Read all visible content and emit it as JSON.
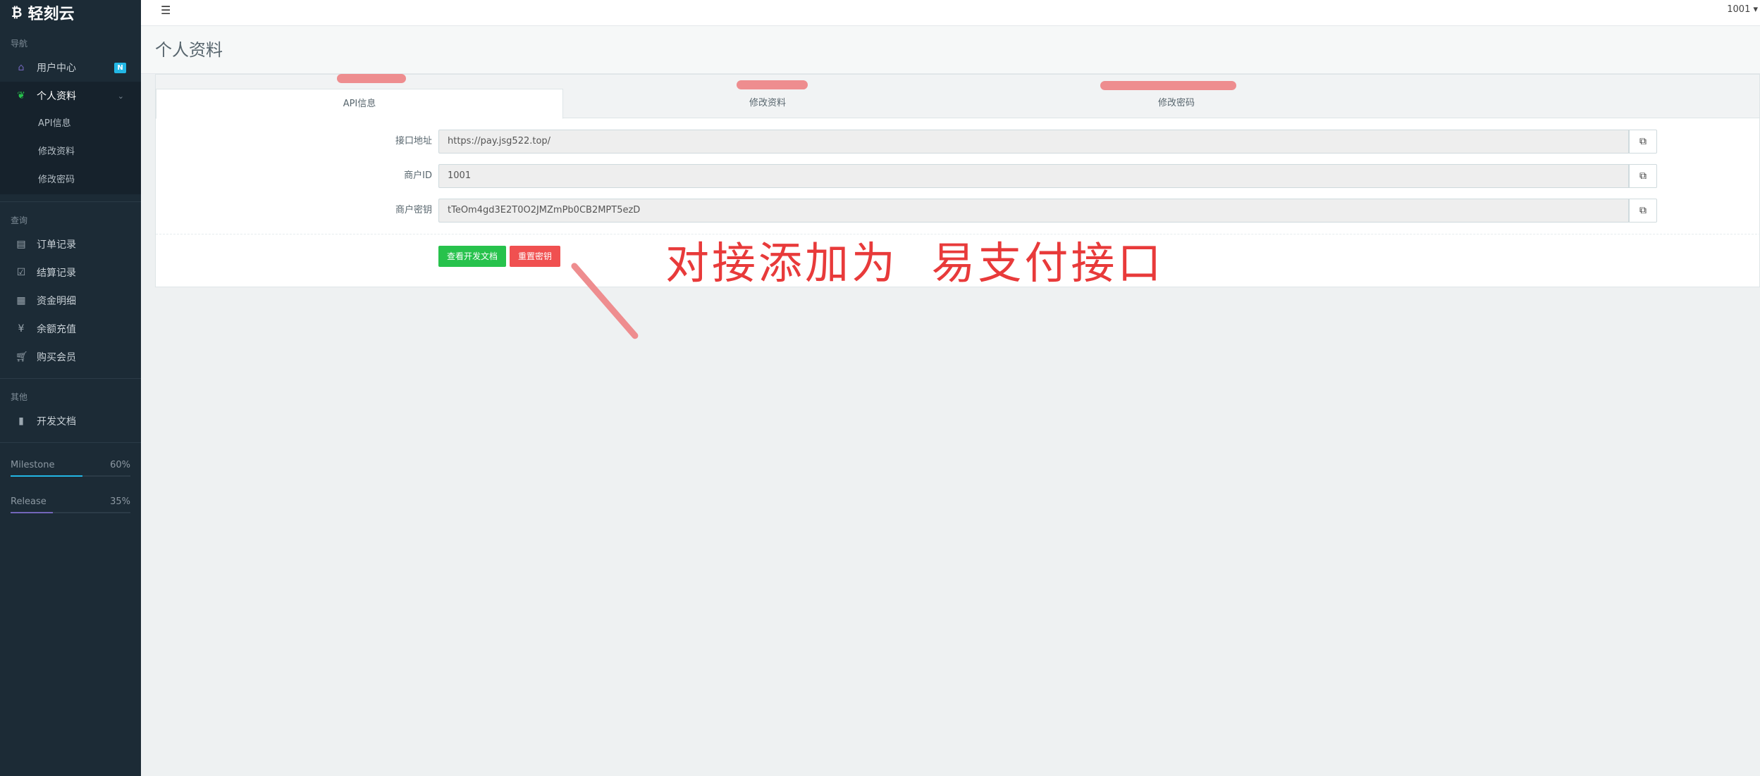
{
  "sidebar": {
    "brand": "轻刻云",
    "sections": {
      "nav": "导航",
      "query": "查询",
      "other": "其他"
    },
    "items": {
      "user_center": "用户中心",
      "user_center_badge": "N",
      "profile": "个人资料",
      "profile_sub": [
        "API信息",
        "修改资料",
        "修改密码"
      ],
      "orders": "订单记录",
      "settlements": "结算记录",
      "funds": "资金明细",
      "recharge": "余额充值",
      "membership": "购买会员",
      "docs": "开发文档"
    },
    "progress": [
      {
        "label": "Milestone",
        "value_text": "60%",
        "value": 60,
        "color": "#23b7e5"
      },
      {
        "label": "Release",
        "value_text": "35%",
        "value": 35,
        "color": "#7266ba"
      }
    ]
  },
  "header": {
    "user": "1001 ▾"
  },
  "page": {
    "title": "个人资料"
  },
  "tabs": [
    "API信息",
    "修改资料",
    "修改密码"
  ],
  "form": {
    "fields": [
      {
        "label": "接口地址",
        "value": "https://pay.jsg522.top/"
      },
      {
        "label": "商户ID",
        "value": "1001"
      },
      {
        "label": "商户密钥",
        "value": "tTeOm4gd3E2T0O2JMZmPb0CB2MPT5ezD"
      }
    ],
    "buttons": {
      "docs": "查看开发文档",
      "reset": "重置密钥"
    }
  },
  "annotation": {
    "text": "对接添加为  易支付接口"
  },
  "colors": {
    "sidebar_bg": "#1c2b36",
    "accent_green": "#27c24c",
    "accent_red": "#f05050",
    "badge_blue": "#23b7e5",
    "annotation_red": "#e83a3a"
  }
}
